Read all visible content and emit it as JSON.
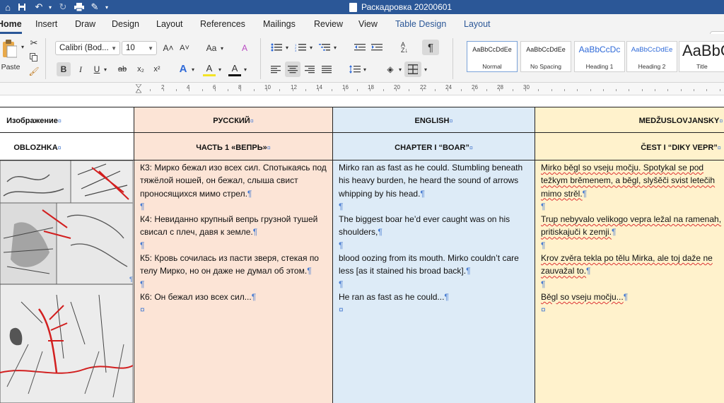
{
  "window": {
    "title": "Раскадровка 20200601"
  },
  "tabs": [
    "Home",
    "Insert",
    "Draw",
    "Design",
    "Layout",
    "References",
    "Mailings",
    "Review",
    "View",
    "Table Design",
    "Layout"
  ],
  "ribbon": {
    "paste_label": "Paste",
    "font_name": "Calibri (Bod...",
    "font_size": "10",
    "grow_font": "A˄",
    "shrink_font": "A˅",
    "change_case": "Aa",
    "bold": "B",
    "italic": "I",
    "underline": "U",
    "strikethrough": "ab",
    "subscript": "x₂",
    "superscript": "x²",
    "font_color": "A",
    "highlight": "A",
    "clear_format": "A",
    "pilcrow": "¶",
    "styles": [
      {
        "preview": "AaBbCcDdEe",
        "name": "Normal"
      },
      {
        "preview": "AaBbCcDdEe",
        "name": "No Spacing"
      },
      {
        "preview": "AaBbCcDc",
        "name": "Heading 1"
      },
      {
        "preview": "AaBbCcDdEe",
        "name": "Heading 2"
      },
      {
        "preview": "AaBbC",
        "name": "Title"
      }
    ]
  },
  "ruler": {
    "numbers": [
      "2",
      "4",
      "6",
      "8",
      "10",
      "12",
      "14",
      "16",
      "18",
      "20",
      "22",
      "24",
      "26",
      "28",
      "30"
    ]
  },
  "table": {
    "headers": [
      "Изображение",
      "РУССКИЙ",
      "ENGLISH",
      "MEDŽUSLOVJANSKY"
    ],
    "row2": [
      "OBLOZHKA",
      "ЧАСТЬ 1 «ВЕПРЬ»",
      "CHAPTER I “BOAR”",
      "ČEST I “DIKY VEPR”"
    ],
    "russian": [
      "К3: Мирко бежал изо всех сил. Спотыкаясь под тяжёлой ношей, он бежал, слыша свист проносящихся мимо стрел.",
      "К4: Невиданно крупный вепрь грузной тушей свисал с плеч, давя к земле.",
      "К5: Кровь сочилась из пасти зверя, стекая по телу Мирко, но он даже не думал об этом.",
      "К6: Он бежал изо всех сил..."
    ],
    "english": [
      "Mirko ran as fast as he could. Stumbling beneath his heavy burden, he heard the sound of arrows whipping by his head.",
      "The biggest boar he’d ever caught was on his shoulders,",
      "blood oozing from its mouth. Mirko couldn’t care less [as it stained his broad back].",
      "He ran as fast as he could..."
    ],
    "interslavic": [
      "Mirko běgl so vseju močju. Spotykal se pod težkym brěmenem, a běgl, slyšěči svist letečih mimo strěl.",
      "Trup nebyvalo velikogo vepra ležal na ramenah, pritiskajuči k zemji.",
      "Krov zvěra tekla po tělu Mirka, ale toj daže ne zauvažal to.",
      "Běgl so vseju močju..."
    ]
  },
  "colors": {
    "titlebar": "#2b5797",
    "russian_col": "#fce4d6",
    "english_col": "#ddebf7",
    "interslavic_col": "#fff2cc"
  }
}
